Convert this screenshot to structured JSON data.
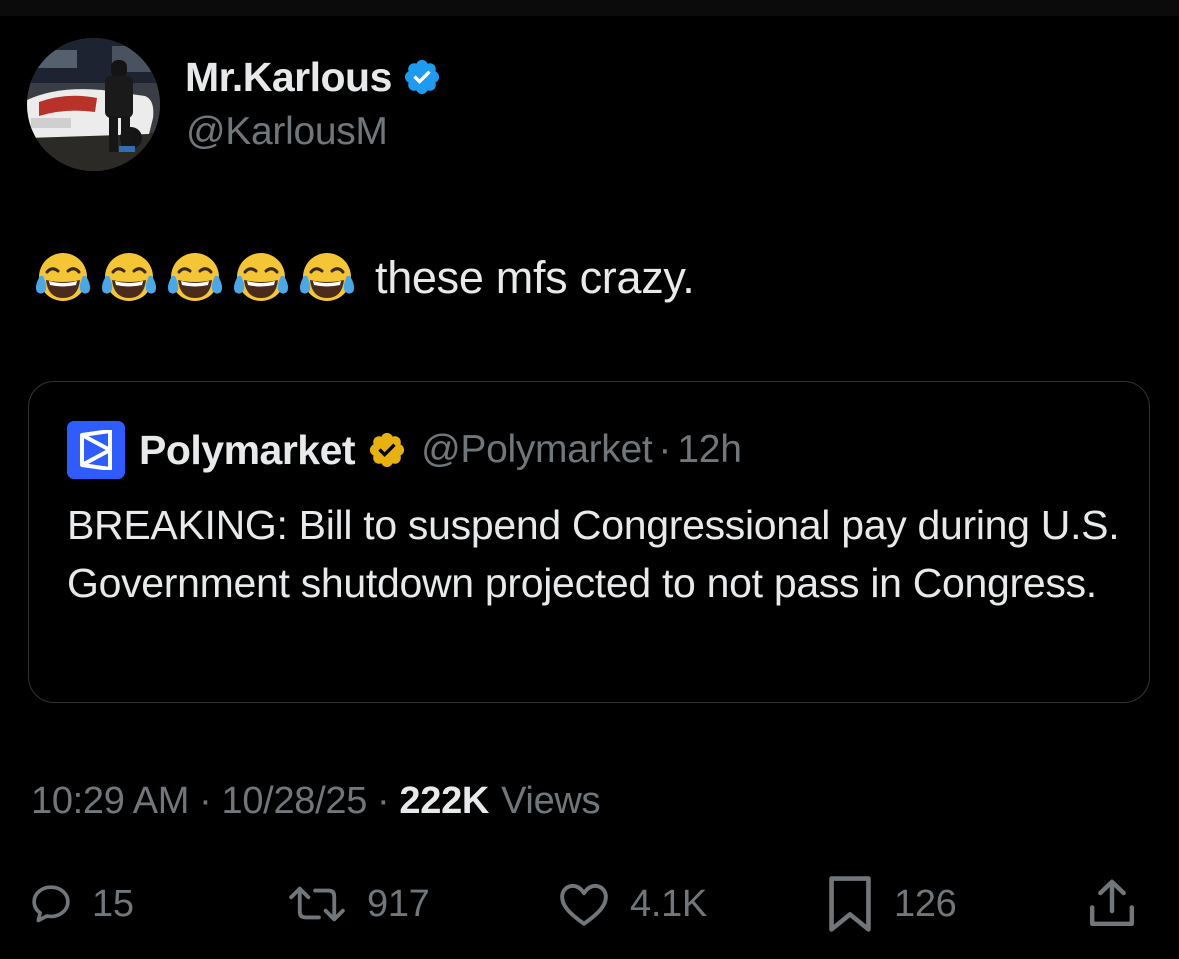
{
  "author": {
    "display_name": "Mr.Karlous",
    "handle": "@KarlousM",
    "verified_badge_color": "#1d9bf0",
    "avatar_icon": "avatar-photo"
  },
  "tweet": {
    "emoji": [
      "😂",
      "😂",
      "😂",
      "😂",
      "😂"
    ],
    "text": "these mfs crazy."
  },
  "quote": {
    "display_name": "Polymarket",
    "handle": "@Polymarket",
    "separator": "·",
    "time": "12h",
    "verified_badge_color": "#e8b20e",
    "logo_color": "#2e5cff",
    "body": "BREAKING: Bill to suspend Congressional pay during U.S. Government shutdown projected to not pass in Congress."
  },
  "meta": {
    "time": "10:29 AM",
    "separator": "·",
    "date": "10/28/25",
    "views_count": "222K",
    "views_label": "Views"
  },
  "actions": {
    "reply_count": "15",
    "retweet_count": "917",
    "like_count": "4.1K",
    "bookmark_count": "126"
  },
  "colors": {
    "background": "#000000",
    "text_primary": "#e7e9ea",
    "text_secondary": "#71767b",
    "border": "#2f3336"
  }
}
